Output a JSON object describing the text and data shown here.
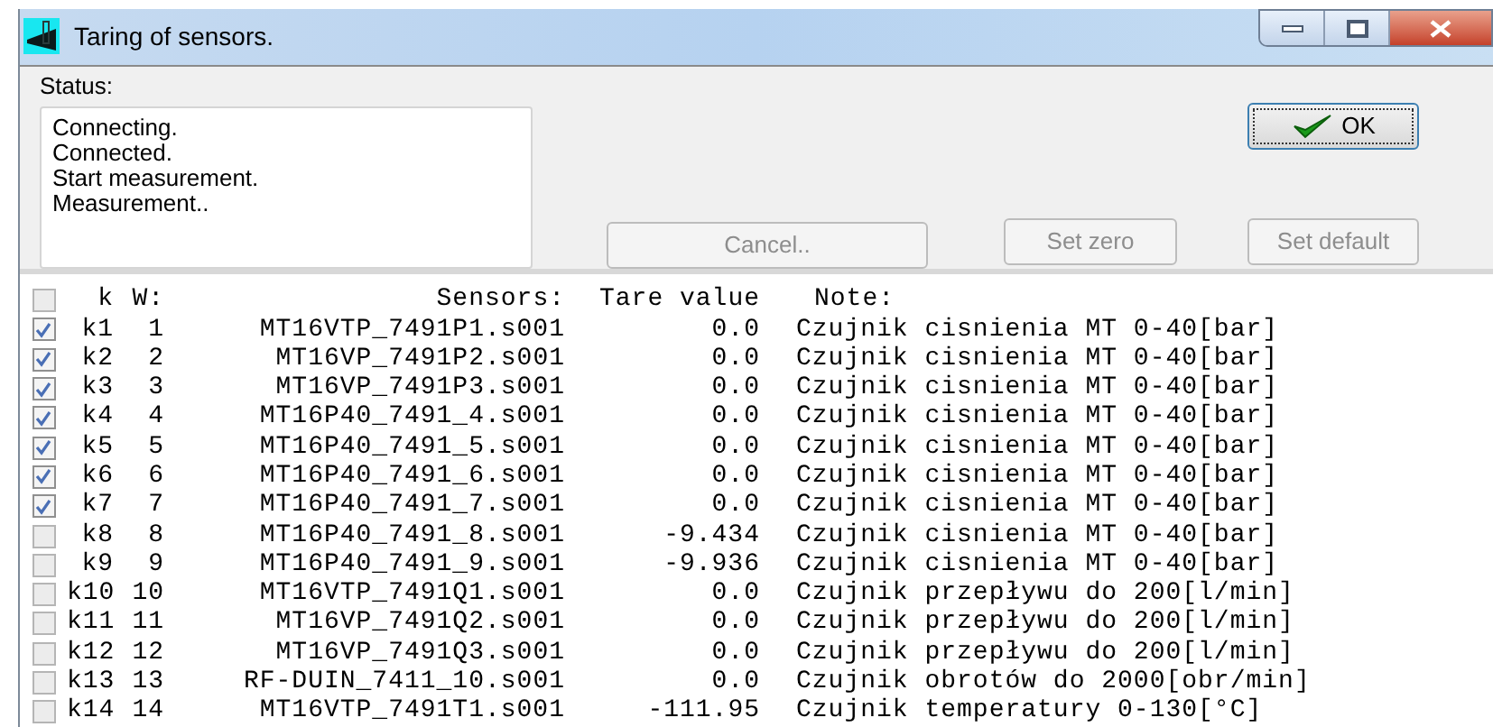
{
  "window": {
    "title": "Taring of sensors."
  },
  "status": {
    "label": "Status:",
    "lines": [
      "Connecting.",
      "Connected.",
      "Start measurement.",
      "Measurement.."
    ]
  },
  "buttons": [
    {
      "kind": "ok",
      "label": "OK",
      "disabled": false
    },
    {
      "kind": "cancel",
      "label": "Cancel..",
      "disabled": true
    },
    {
      "kind": "zero",
      "label": "Set zero",
      "disabled": true
    },
    {
      "kind": "default",
      "label": "Set default",
      "disabled": true
    }
  ],
  "table": {
    "header": {
      "checked": false,
      "k": "k",
      "w": "W:",
      "sensor": "Sensors:",
      "tare": "Tare value",
      "note": "Note:"
    },
    "rows": [
      {
        "checked": true,
        "k": "k1",
        "w": "1",
        "sensor": "MT16VTP_7491P1.s001",
        "tare": "0.0",
        "note": "Czujnik cisnienia MT 0-40[bar]"
      },
      {
        "checked": true,
        "k": "k2",
        "w": "2",
        "sensor": "MT16VP_7491P2.s001",
        "tare": "0.0",
        "note": "Czujnik cisnienia MT 0-40[bar]"
      },
      {
        "checked": true,
        "k": "k3",
        "w": "3",
        "sensor": "MT16VP_7491P3.s001",
        "tare": "0.0",
        "note": "Czujnik cisnienia MT 0-40[bar]"
      },
      {
        "checked": true,
        "k": "k4",
        "w": "4",
        "sensor": "MT16P40_7491_4.s001",
        "tare": "0.0",
        "note": "Czujnik cisnienia MT 0-40[bar]"
      },
      {
        "checked": true,
        "k": "k5",
        "w": "5",
        "sensor": "MT16P40_7491_5.s001",
        "tare": "0.0",
        "note": "Czujnik cisnienia MT 0-40[bar]"
      },
      {
        "checked": true,
        "k": "k6",
        "w": "6",
        "sensor": "MT16P40_7491_6.s001",
        "tare": "0.0",
        "note": "Czujnik cisnienia MT 0-40[bar]"
      },
      {
        "checked": true,
        "k": "k7",
        "w": "7",
        "sensor": "MT16P40_7491_7.s001",
        "tare": "0.0",
        "note": "Czujnik cisnienia MT 0-40[bar]"
      },
      {
        "checked": false,
        "k": "k8",
        "w": "8",
        "sensor": "MT16P40_7491_8.s001",
        "tare": "-9.434",
        "note": "Czujnik cisnienia MT 0-40[bar]"
      },
      {
        "checked": false,
        "k": "k9",
        "w": "9",
        "sensor": "MT16P40_7491_9.s001",
        "tare": "-9.936",
        "note": "Czujnik cisnienia MT 0-40[bar]"
      },
      {
        "checked": false,
        "k": "k10",
        "w": "10",
        "sensor": "MT16VTP_7491Q1.s001",
        "tare": "0.0",
        "note": "Czujnik przepływu do 200[l/min]"
      },
      {
        "checked": false,
        "k": "k11",
        "w": "11",
        "sensor": "MT16VP_7491Q2.s001",
        "tare": "0.0",
        "note": "Czujnik przepływu do 200[l/min]"
      },
      {
        "checked": false,
        "k": "k12",
        "w": "12",
        "sensor": "MT16VP_7491Q3.s001",
        "tare": "0.0",
        "note": "Czujnik przepływu do 200[l/min]"
      },
      {
        "checked": false,
        "k": "k13",
        "w": "13",
        "sensor": "RF-DUIN_7411_10.s001",
        "tare": "0.0",
        "note": "Czujnik obrotów do 2000[obr/min]"
      },
      {
        "checked": false,
        "k": "k14",
        "w": "14",
        "sensor": "MT16VTP_7491T1.s001",
        "tare": "-111.95",
        "note": "Czujnik temperatury 0-130[°C]"
      }
    ]
  }
}
